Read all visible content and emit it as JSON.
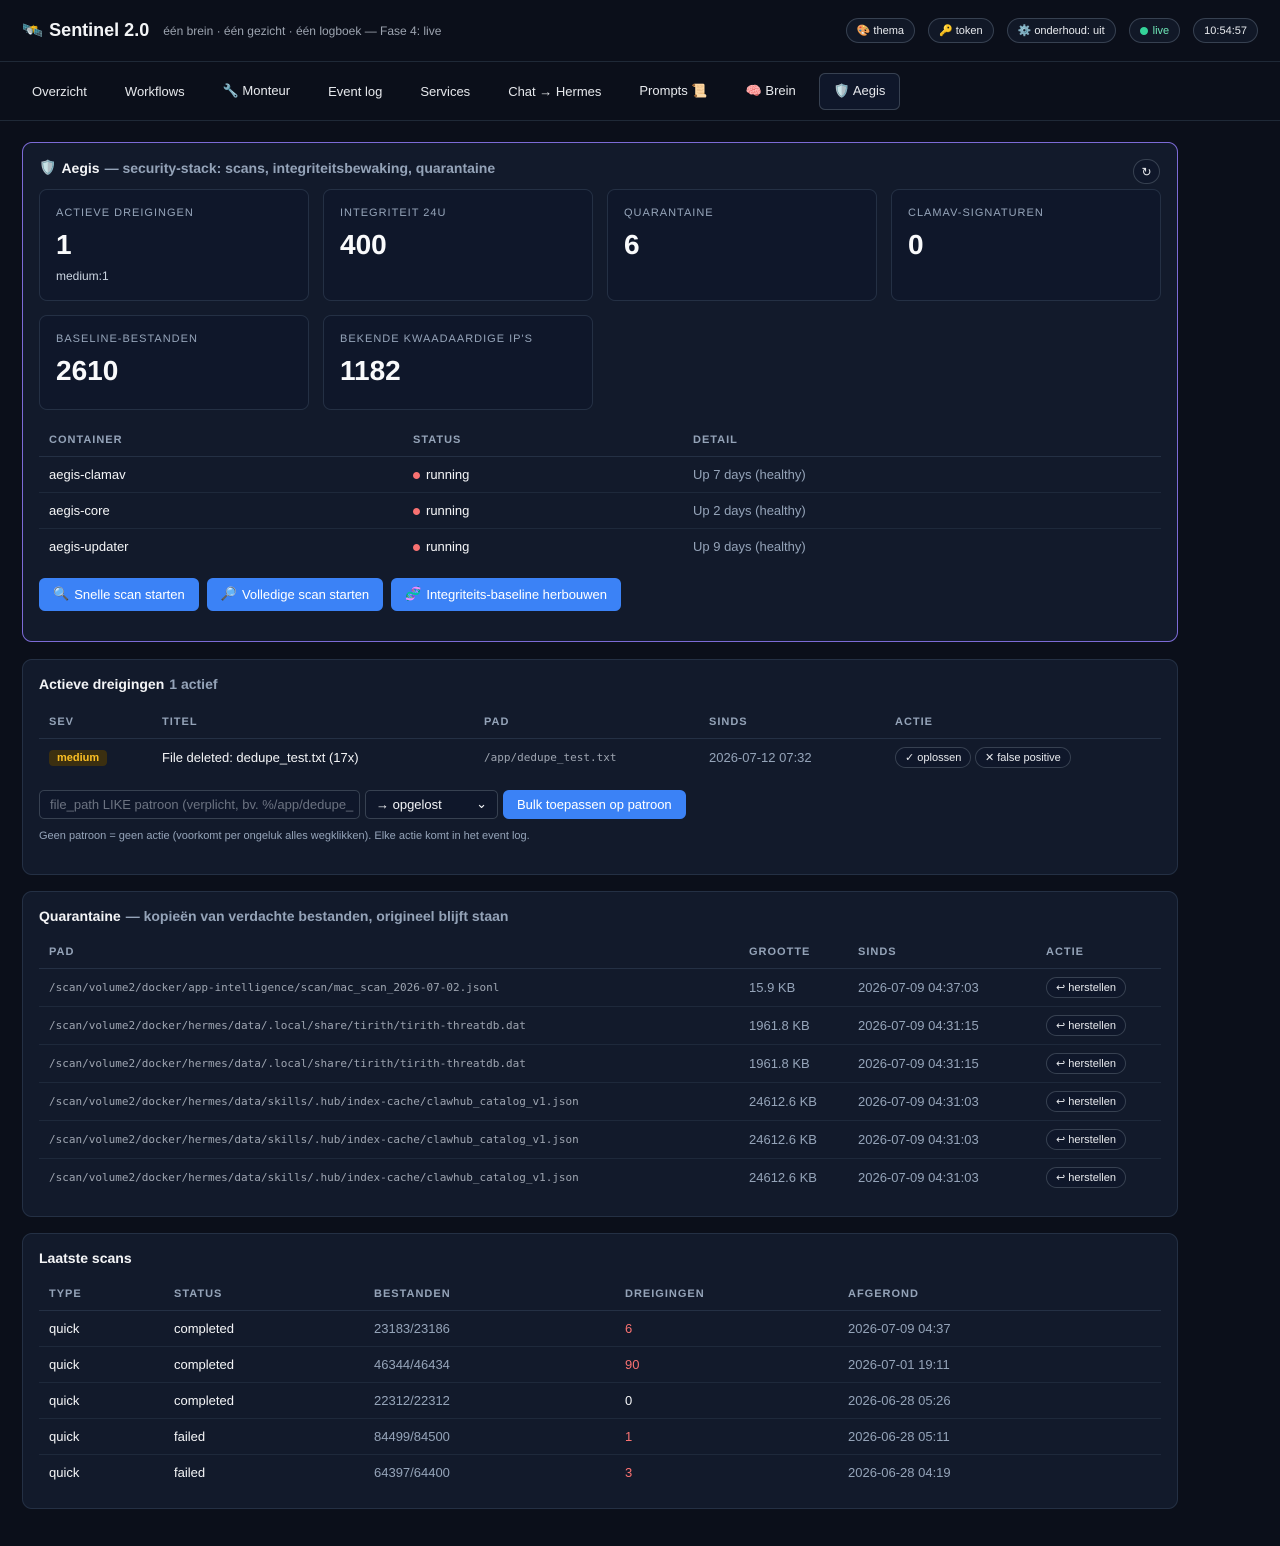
{
  "header": {
    "brand_icon": "🛰️",
    "title": "Sentinel 2.0",
    "subtitle": "één brein · één gezicht · één logboek — Fase 4: live",
    "pills": [
      {
        "icon": "🎨",
        "label": "thema"
      },
      {
        "icon": "🔑",
        "label": "token"
      },
      {
        "icon": "⚙️",
        "label": "onderhoud: uit"
      }
    ],
    "live_label": "live",
    "clock": "10:54:57"
  },
  "nav": {
    "tabs": [
      {
        "label": "Overzicht"
      },
      {
        "label": "Workflows"
      },
      {
        "label": "🔧 Monteur"
      },
      {
        "label": "Event log"
      },
      {
        "label": "Services"
      },
      {
        "label": "Chat → Hermes"
      },
      {
        "label": "Prompts 📜"
      },
      {
        "label": "🧠 Brein"
      },
      {
        "label": "🛡️ Aegis"
      }
    ],
    "active": "🛡️ Aegis"
  },
  "aegis": {
    "icon": "🛡️",
    "title": "Aegis",
    "subtitle": "— security-stack: scans, integriteitsbewaking, quarantaine",
    "refresh_icon": "↻",
    "stats": [
      {
        "label": "ACTIEVE DREIGINGEN",
        "value": "1",
        "sub": "medium:1"
      },
      {
        "label": "INTEGRITEIT 24U",
        "value": "400"
      },
      {
        "label": "QUARANTAINE",
        "value": "6"
      },
      {
        "label": "CLAMAV-SIGNATUREN",
        "value": "0"
      },
      {
        "label": "BASELINE-BESTANDEN",
        "value": "2610"
      },
      {
        "label": "BEKENDE KWAADAARDIGE IP'S",
        "value": "1182"
      }
    ],
    "container_headers": [
      "CONTAINER",
      "STATUS",
      "DETAIL"
    ],
    "containers": [
      {
        "name": "aegis-clamav",
        "status": "running",
        "detail": "Up 7 days (healthy)"
      },
      {
        "name": "aegis-core",
        "status": "running",
        "detail": "Up 2 days (healthy)"
      },
      {
        "name": "aegis-updater",
        "status": "running",
        "detail": "Up 9 days (healthy)"
      }
    ],
    "actions": [
      {
        "icon": "🔍",
        "label": "Snelle scan starten"
      },
      {
        "icon": "🔎",
        "label": "Volledige scan starten"
      },
      {
        "icon": "🧬",
        "label": "Integriteits-baseline herbouwen"
      }
    ]
  },
  "threats": {
    "title": "Actieve dreigingen",
    "count_label": "1 actief",
    "headers": [
      "SEV",
      "TITEL",
      "PAD",
      "SINDS",
      "ACTIE"
    ],
    "rows": [
      {
        "sev": "medium",
        "title": "File deleted: dedupe_test.txt (17x)",
        "path": "/app/dedupe_test.txt",
        "since": "2026-07-12 07:32",
        "resolve": "✓ oplossen",
        "false_positive": "✕ false positive"
      }
    ],
    "pattern_placeholder": "file_path LIKE patroon (verplicht, bv. %/app/dedupe_",
    "select_value": "→ opgelost",
    "bulk_label": "Bulk toepassen op patroon",
    "hint": "Geen patroon = geen actie (voorkomt per ongeluk alles wegklikken). Elke actie komt in het event log."
  },
  "quarantine": {
    "title": "Quarantaine",
    "subtitle": "— kopieën van verdachte bestanden, origineel blijft staan",
    "headers": [
      "PAD",
      "GROOTTE",
      "SINDS",
      "ACTIE"
    ],
    "rows": [
      {
        "path": "/scan/volume2/docker/app-intelligence/scan/mac_scan_2026-07-02.jsonl",
        "size": "15.9 KB",
        "since": "2026-07-09 04:37:03",
        "action": "↩ herstellen"
      },
      {
        "path": "/scan/volume2/docker/hermes/data/.local/share/tirith/tirith-threatdb.dat",
        "size": "1961.8 KB",
        "since": "2026-07-09 04:31:15",
        "action": "↩ herstellen"
      },
      {
        "path": "/scan/volume2/docker/hermes/data/.local/share/tirith/tirith-threatdb.dat",
        "size": "1961.8 KB",
        "since": "2026-07-09 04:31:15",
        "action": "↩ herstellen"
      },
      {
        "path": "/scan/volume2/docker/hermes/data/skills/.hub/index-cache/clawhub_catalog_v1.json",
        "size": "24612.6 KB",
        "since": "2026-07-09 04:31:03",
        "action": "↩ herstellen"
      },
      {
        "path": "/scan/volume2/docker/hermes/data/skills/.hub/index-cache/clawhub_catalog_v1.json",
        "size": "24612.6 KB",
        "since": "2026-07-09 04:31:03",
        "action": "↩ herstellen"
      },
      {
        "path": "/scan/volume2/docker/hermes/data/skills/.hub/index-cache/clawhub_catalog_v1.json",
        "size": "24612.6 KB",
        "since": "2026-07-09 04:31:03",
        "action": "↩ herstellen"
      }
    ]
  },
  "scans": {
    "title": "Laatste scans",
    "headers": [
      "TYPE",
      "STATUS",
      "BESTANDEN",
      "DREIGINGEN",
      "AFGEROND"
    ],
    "rows": [
      {
        "type": "quick",
        "status": "completed",
        "files": "23183/23186",
        "threats": "6",
        "done": "2026-07-09 04:37"
      },
      {
        "type": "quick",
        "status": "completed",
        "files": "46344/46434",
        "threats": "90",
        "done": "2026-07-01 19:11"
      },
      {
        "type": "quick",
        "status": "completed",
        "files": "22312/22312",
        "threats": "0",
        "done": "2026-06-28 05:26"
      },
      {
        "type": "quick",
        "status": "failed",
        "files": "84499/84500",
        "threats": "1",
        "done": "2026-06-28 05:11"
      },
      {
        "type": "quick",
        "status": "failed",
        "files": "64397/64400",
        "threats": "3",
        "done": "2026-06-28 04:19"
      }
    ]
  },
  "colors": {
    "background": "#0b0f1a",
    "panel": "#121a2b",
    "accent_blue": "#3b82f6",
    "accent_purple": "#7c6bd6",
    "danger": "#f87171",
    "live": "#34d399",
    "warning": "#fbbf24"
  }
}
